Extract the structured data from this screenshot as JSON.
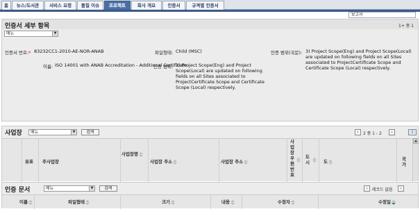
{
  "nav": {
    "tabs": [
      {
        "label": "홈",
        "active": false
      },
      {
        "label": "뉴스/도서관",
        "active": false
      },
      {
        "label": "서비스 요청",
        "active": false
      },
      {
        "label": "품질 이슈",
        "active": false
      },
      {
        "label": "프로젝트",
        "active": true
      },
      {
        "label": "회사 개요",
        "active": false
      },
      {
        "label": "인증서",
        "active": false
      },
      {
        "label": "규격별 인증서",
        "active": false
      }
    ]
  },
  "search": {
    "value": "보고서"
  },
  "certificate": {
    "title": "인증서 세부 항목",
    "menu_label": "메뉴",
    "record_count": "1+ 중 1",
    "fields": {
      "cert_number_label": "인증서 번호:",
      "cert_number_value": "83232CC1-2010-AE-NOR-ANAB",
      "file_type_label": "파일형태:",
      "file_type_value": "Child (MSC)",
      "scope_local_label": "인증 범위(국문):",
      "scope_local_value": "3) Project Scope(Eng) and Project Scope(Local) are updated on following fields on all Sites associated to ProjectCertificate Scope and Certificate Scope (Local) respectively.",
      "name_label": "이름:",
      "name_value": "ISO 14001 with ANAB Accreditation - Additional Certificate",
      "scope_label": "인증 범위:",
      "scope_value": "3) Project Scope(Eng) and Project Scope(Local) are updated on following fields on all Sites associated to ProjectCertificate Scope and Certificate Scope (Local) respectively."
    }
  },
  "sites": {
    "title": "사업장",
    "menu_label": "메뉴",
    "search_button": "검색",
    "pager": "2 중 1 - 2",
    "columns": {
      "type": "유표",
      "main_site": "주사업장",
      "site_name": "사업장명",
      "site_address": "사업장 주소",
      "site_address2": "사업장 주소",
      "postal": "사업장우편번호",
      "city": "도시",
      "province": "도",
      "country": "국가"
    }
  },
  "documents": {
    "title": "인증 문서",
    "menu_label": "메뉴",
    "search_button": "검색",
    "no_records": "레코드 없음",
    "columns": {
      "name": "이름",
      "file_type": "파일형태",
      "size": "크기",
      "content": "내용",
      "modified_by": "수정자",
      "modified_date": "수정일"
    }
  }
}
